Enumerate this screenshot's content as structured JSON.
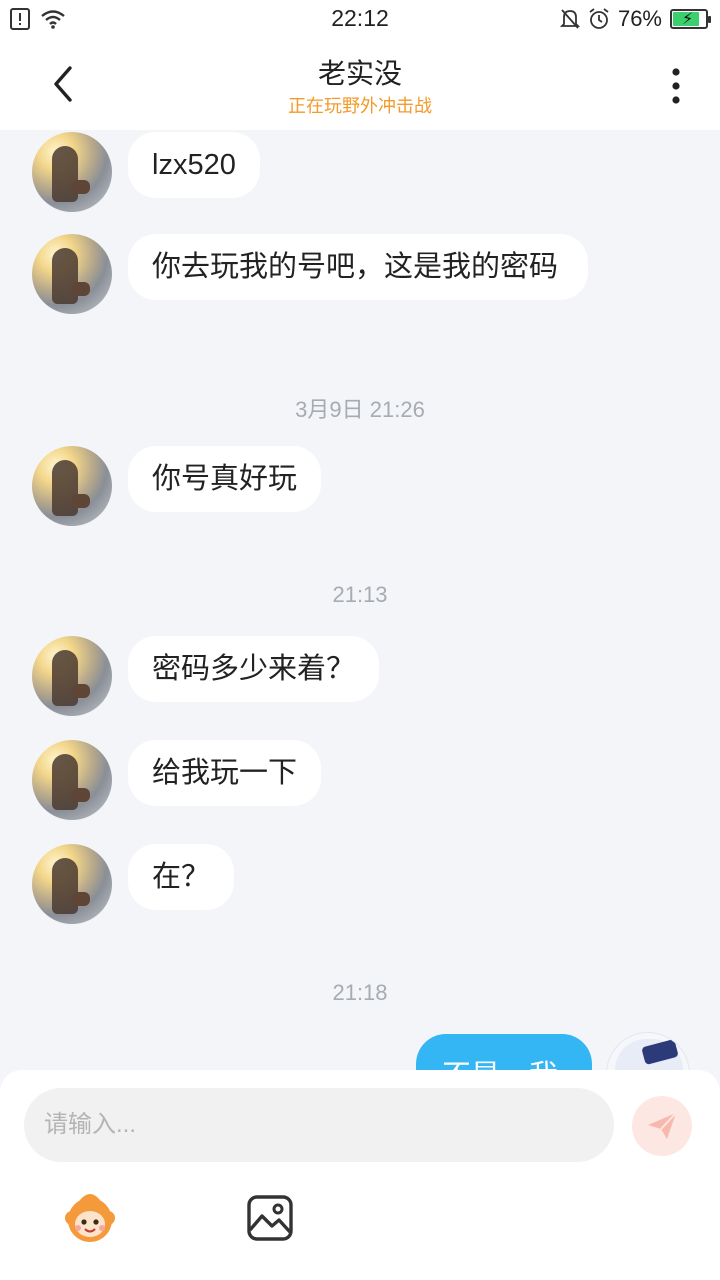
{
  "status_bar": {
    "time": "22:12",
    "battery_percent": "76%",
    "battery_level": 0.76
  },
  "header": {
    "title": "老实没",
    "subtitle": "正在玩野外冲击战"
  },
  "messages": [
    {
      "type": "incoming",
      "text": "lzx520"
    },
    {
      "type": "incoming",
      "text": "你去玩我的号吧，这是我的密码"
    },
    {
      "type": "timestamp",
      "text": "3月9日 21:26"
    },
    {
      "type": "incoming",
      "text": "你号真好玩"
    },
    {
      "type": "timestamp",
      "text": "21:13"
    },
    {
      "type": "incoming",
      "text": "密码多少来着？"
    },
    {
      "type": "incoming",
      "text": "给我玩一下"
    },
    {
      "type": "incoming",
      "text": "在？"
    },
    {
      "type": "timestamp",
      "text": "21:18"
    },
    {
      "type": "outgoing",
      "text": "不是，我"
    }
  ],
  "input": {
    "placeholder": "请输入..."
  },
  "icons": {
    "back": "chevron-left-icon",
    "more": "more-vertical-icon",
    "send": "send-icon",
    "emoji": "emoji-icon",
    "image": "image-icon"
  },
  "colors": {
    "accent": "#35b6f4",
    "subtitle": "#f39a2b",
    "send_bg": "#fde7e2",
    "send_icon": "#f7b9ad"
  }
}
